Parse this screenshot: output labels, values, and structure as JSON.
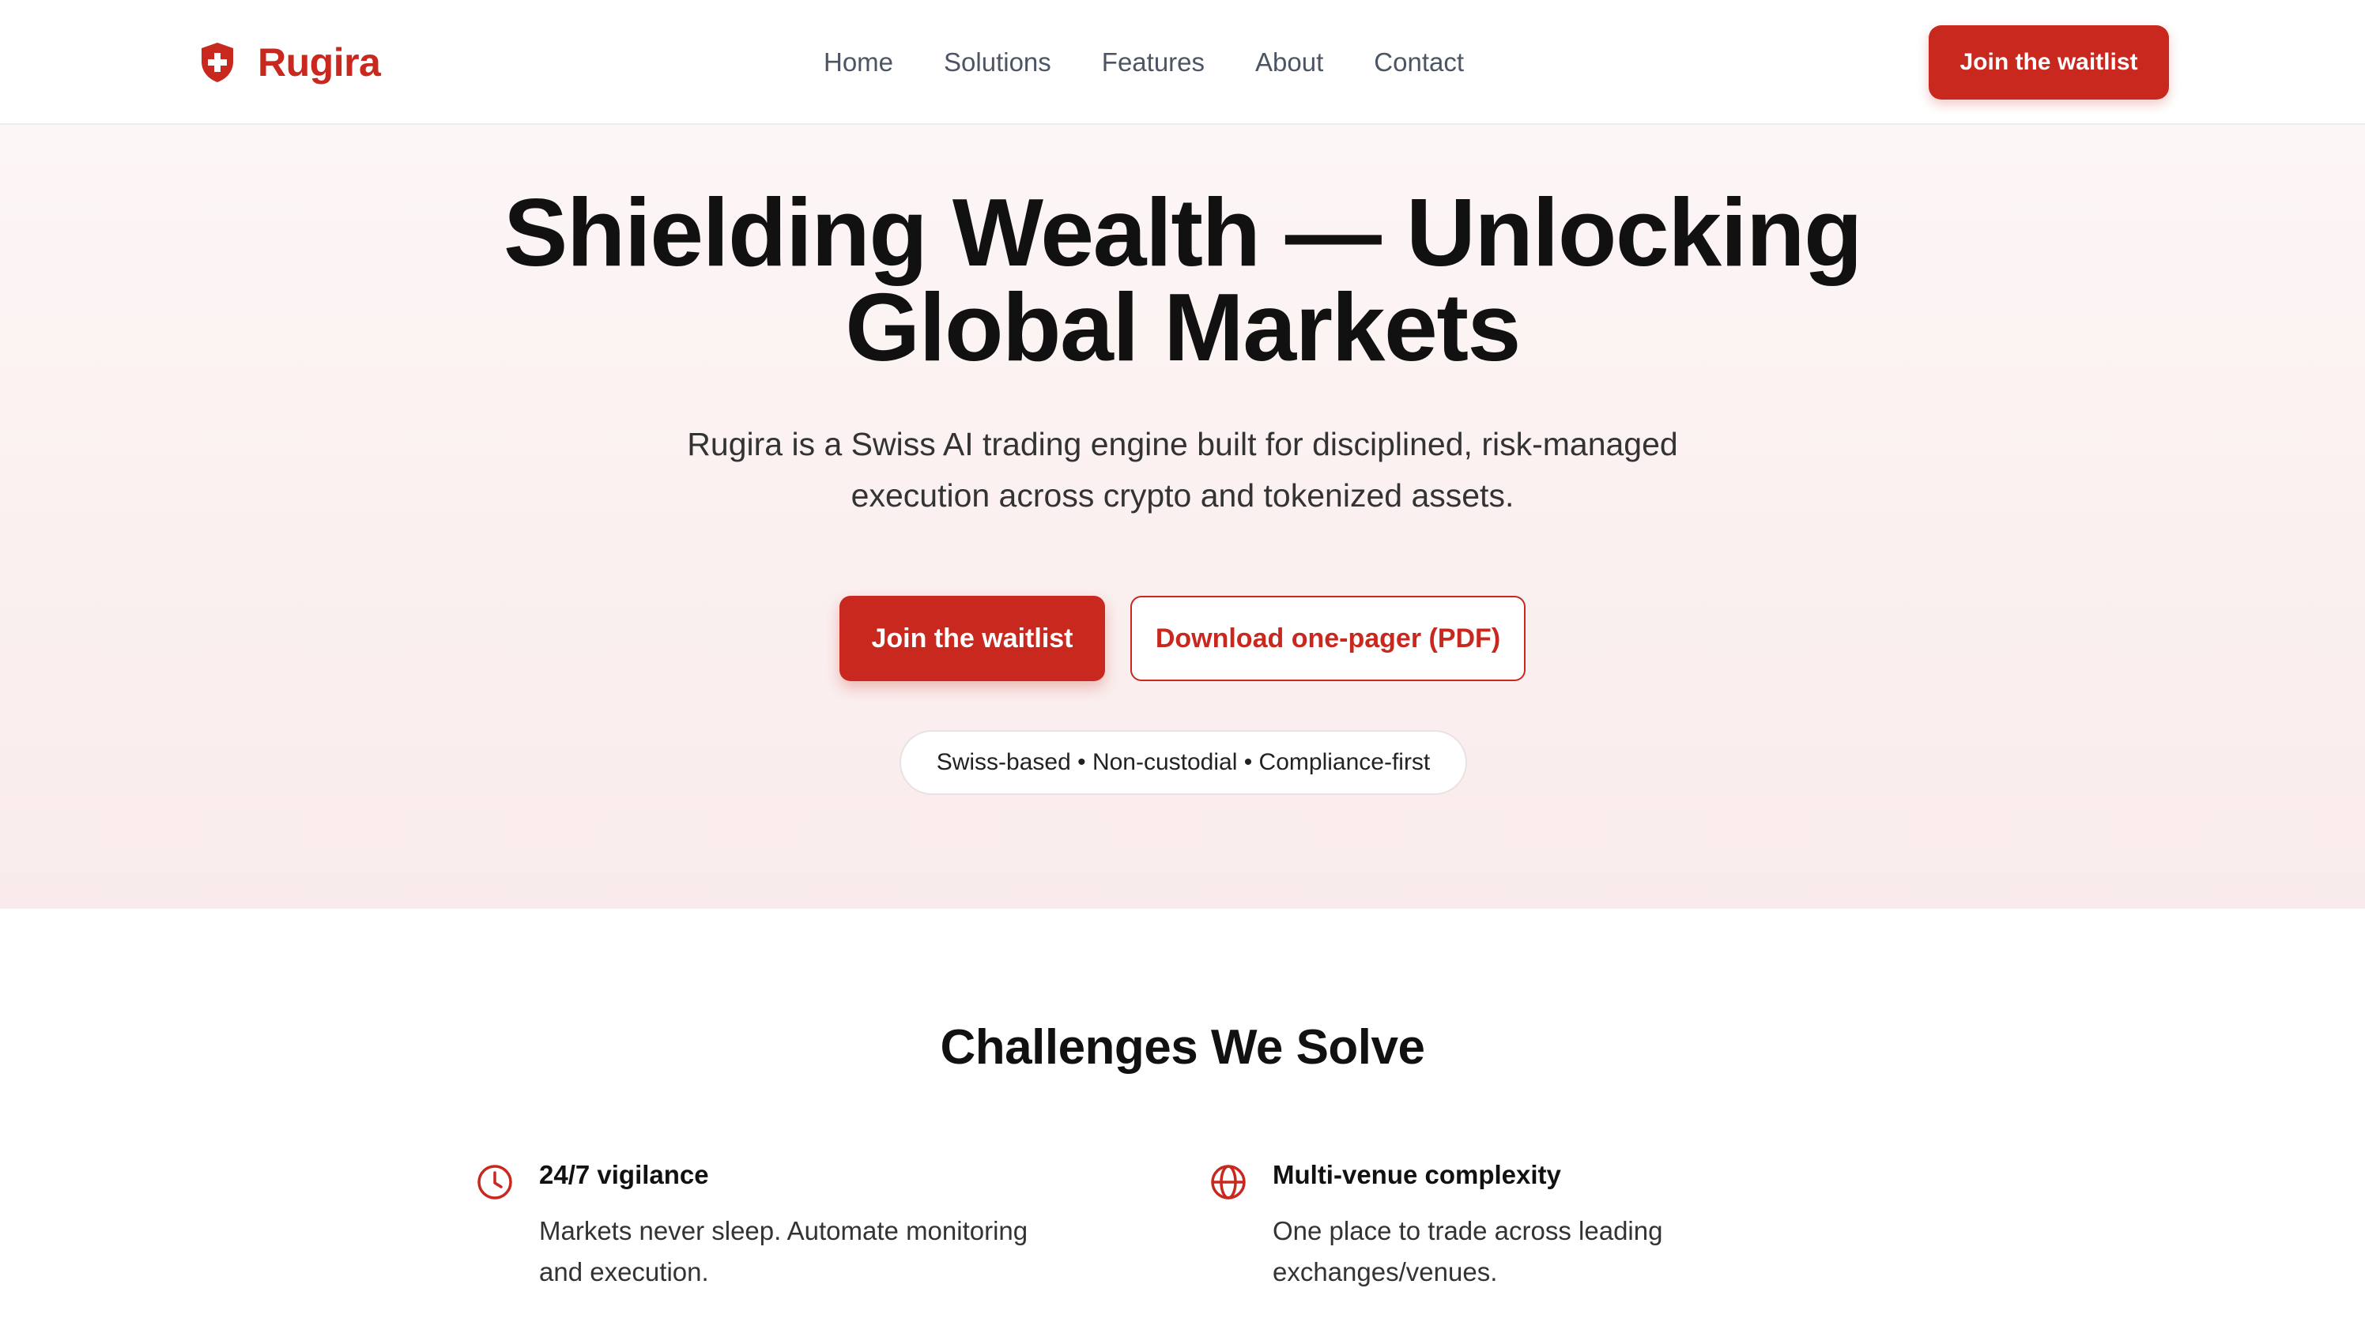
{
  "header": {
    "brand_name": "Rugira",
    "brand_icon": "shield-cross-icon",
    "nav": [
      "Home",
      "Solutions",
      "Features",
      "About",
      "Contact"
    ],
    "cta_label": "Join the waitlist"
  },
  "hero": {
    "title_line1": "Shielding Wealth — Unlocking",
    "title_line2": "Global Markets",
    "subtitle": "Rugira is a Swiss AI trading engine built for disciplined, risk-managed execution across crypto and tokenized assets.",
    "primary_cta": "Join the waitlist",
    "secondary_cta": "Download one-pager (PDF)",
    "badge": "Swiss-based • Non-custodial • Compliance-first"
  },
  "challenges": {
    "title": "Challenges We Solve",
    "items": [
      {
        "icon": "clock-icon",
        "title": "24/7 vigilance",
        "description": "Markets never sleep. Automate monitoring and execution."
      },
      {
        "icon": "globe-icon",
        "title": "Multi-venue complexity",
        "description": "One place to trade across leading exchanges/venues."
      }
    ]
  },
  "colors": {
    "brand_red": "#c8281e",
    "hero_bg_top": "#fdf6f6",
    "hero_bg_bottom": "#f9ebeb"
  }
}
